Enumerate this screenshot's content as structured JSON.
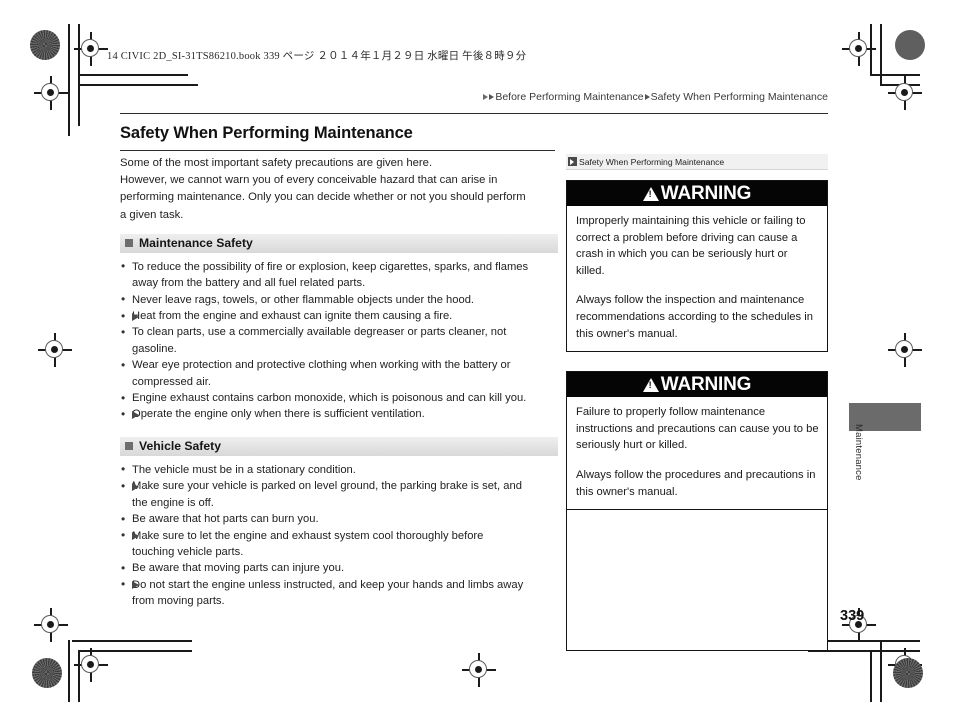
{
  "print": {
    "file_info": "14 CIVIC 2D_SI-31TS86210.book    339 ページ    ２０１４年１月２９日    水曜日    午後８時９分"
  },
  "breadcrumb": {
    "items": [
      "Before Performing Maintenance",
      "Safety When Performing Maintenance"
    ]
  },
  "page": {
    "title": "Safety When Performing Maintenance",
    "number": "339",
    "side_tab_label": "Maintenance"
  },
  "intro": {
    "line1": "Some of the most important safety precautions are given here.",
    "line2": "However, we cannot warn you of every conceivable hazard that can arise in",
    "line3": "performing maintenance. Only you can decide whether or not you should perform",
    "line4": "a given task."
  },
  "sections": [
    {
      "heading": "Maintenance Safety",
      "items": [
        {
          "type": "bullet",
          "lines": [
            "To reduce the possibility of fire or explosion, keep cigarettes, sparks, and flames",
            "away from the battery and all fuel related parts."
          ]
        },
        {
          "type": "bullet",
          "lines": [
            "Never leave rags, towels, or other flammable objects under the hood."
          ]
        },
        {
          "type": "sub",
          "lines": [
            "Heat from the engine and exhaust can ignite them causing a fire."
          ]
        },
        {
          "type": "bullet",
          "lines": [
            "To clean parts, use a commercially available degreaser or parts cleaner, not",
            "gasoline."
          ]
        },
        {
          "type": "bullet",
          "lines": [
            "Wear eye protection and protective clothing when working with the battery or",
            "compressed air."
          ]
        },
        {
          "type": "bullet",
          "lines": [
            "Engine exhaust contains carbon monoxide, which is poisonous and can kill you."
          ]
        },
        {
          "type": "sub",
          "lines": [
            "Operate the engine only when there is sufficient ventilation."
          ]
        }
      ]
    },
    {
      "heading": "Vehicle Safety",
      "items": [
        {
          "type": "bullet",
          "lines": [
            "The vehicle must be in a stationary condition."
          ]
        },
        {
          "type": "sub",
          "lines": [
            "Make sure your vehicle is parked on level ground, the parking brake is set, and",
            "the engine is off."
          ]
        },
        {
          "type": "bullet",
          "lines": [
            "Be aware that hot parts can burn you."
          ]
        },
        {
          "type": "sub",
          "lines": [
            "Make sure to let the engine and exhaust system cool thoroughly before",
            "touching vehicle parts."
          ]
        },
        {
          "type": "bullet",
          "lines": [
            "Be aware that moving parts can injure you."
          ]
        },
        {
          "type": "sub",
          "lines": [
            "Do not start the engine unless instructed, and keep your hands and limbs away",
            "from moving parts."
          ]
        }
      ]
    }
  ],
  "sidebar": {
    "reference_label": "Safety When Performing Maintenance",
    "warnings": [
      {
        "banner": "WARNING",
        "paragraphs": [
          "Improperly maintaining this vehicle or failing to correct a problem before driving can cause a crash in which you can be seriously hurt or killed.",
          "Always follow the inspection and maintenance recommendations according to the schedules in this owner's manual."
        ]
      },
      {
        "banner": "WARNING",
        "paragraphs": [
          "Failure to properly follow maintenance instructions and precautions can cause you to be seriously hurt or killed.",
          "Always follow the procedures and precautions in this owner's manual."
        ]
      }
    ]
  },
  "colors": {
    "warning_banner_bg": "#050505",
    "section_header_bg": "#e2e2e2",
    "side_tab": "#6b6b6b"
  }
}
